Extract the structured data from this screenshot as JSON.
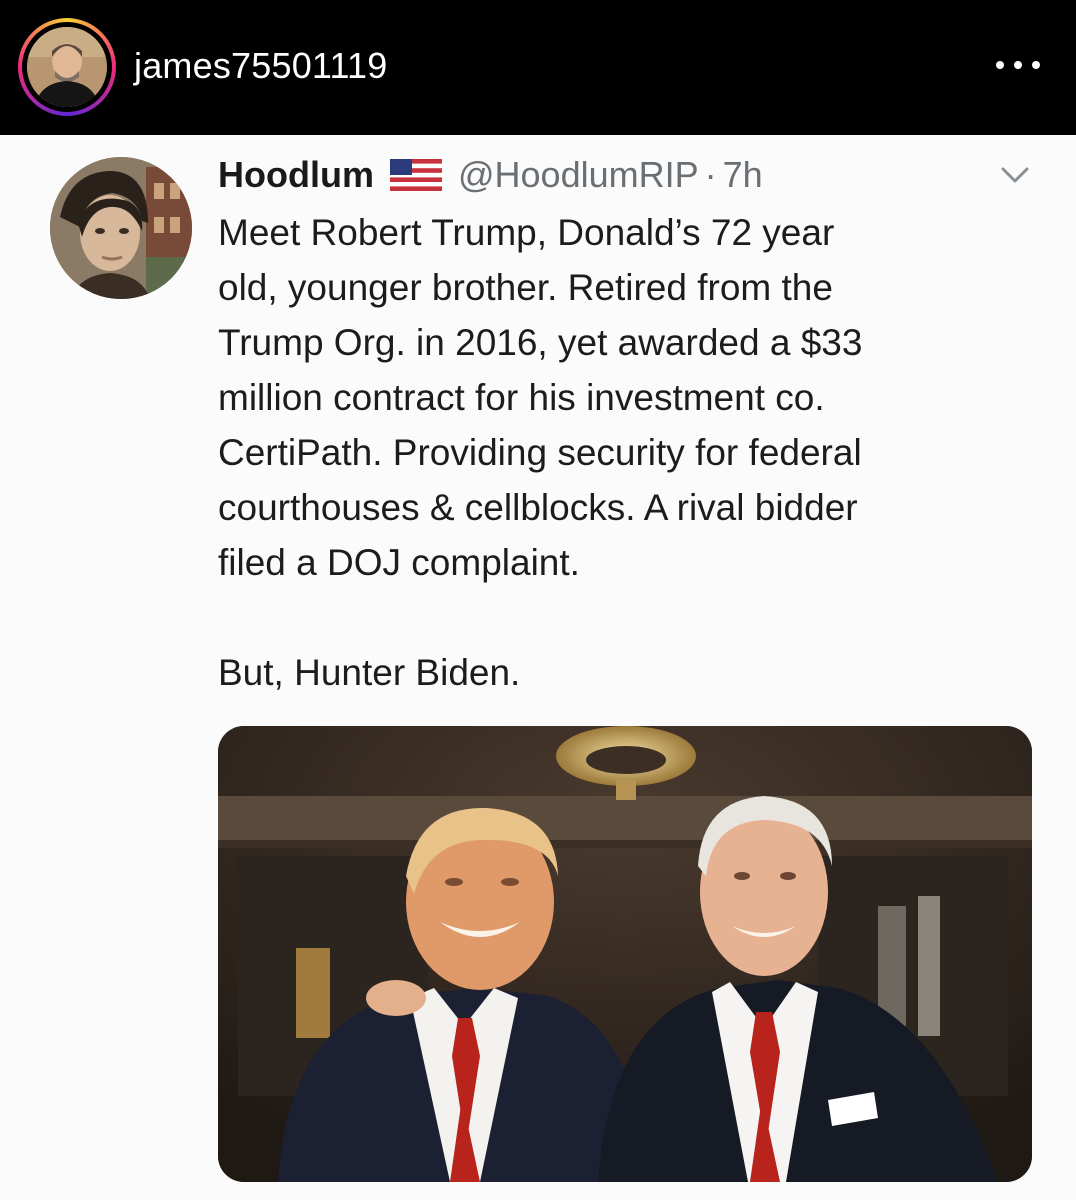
{
  "instagram": {
    "username": "james75501119",
    "more_icon": "more-horizontal-icon"
  },
  "tweet": {
    "display_name": "Hoodlum",
    "flag_icon": "us-flag-icon",
    "handle": "@HoodlumRIP",
    "separator": "·",
    "time": "7h",
    "caret_icon": "chevron-down-icon",
    "lines": [
      "Meet Robert Trump, Donald’s 72 year",
      "old, younger brother. Retired from the",
      "Trump Org. in 2016, yet awarded a $33",
      "million contract for his investment co.",
      "CertiPath. Providing security for federal",
      "courthouses & cellblocks. A rival bidder",
      "filed a DOJ complaint."
    ],
    "closing_line": "But, Hunter Biden."
  },
  "colors": {
    "header_bg": "#000000",
    "text_primary": "#1c1c1c",
    "text_secondary": "#6a6f74",
    "tie_red": "#b8231c"
  }
}
